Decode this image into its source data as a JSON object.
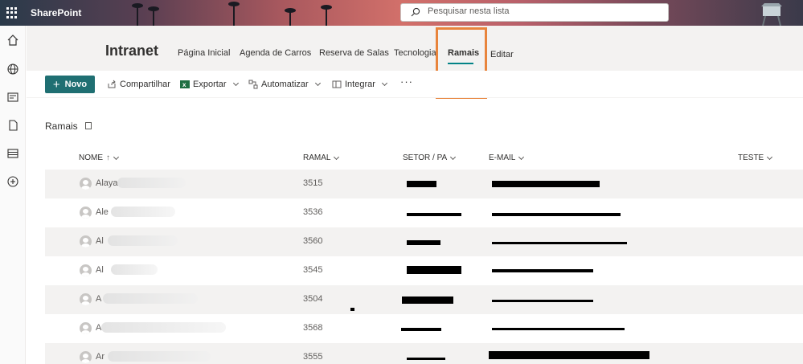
{
  "suite": {
    "brand": "SharePoint",
    "search_placeholder": "Pesquisar nesta lista"
  },
  "site": {
    "title": "Intranet",
    "nav": [
      "Página Inicial",
      "Agenda de Carros",
      "Reserva de Salas",
      "Tecnologia",
      "Ramais",
      "Editar"
    ],
    "active_nav": "Ramais"
  },
  "commands": {
    "new_label": "Novo",
    "share_label": "Compartilhar",
    "export_label": "Exportar",
    "automate_label": "Automatizar",
    "integrate_label": "Integrar",
    "more_label": "···"
  },
  "list": {
    "title": "Ramais",
    "columns": {
      "nome": "NOME",
      "ramal": "RAMAL",
      "setor": "SETOR / PA",
      "email": "E-MAIL",
      "teste": "TESTE"
    },
    "rows": [
      {
        "name": "Alaya",
        "ramal": "3515"
      },
      {
        "name": "Ale",
        "ramal": "3536"
      },
      {
        "name": "Al",
        "ramal": "3560"
      },
      {
        "name": "Al",
        "ramal": "3545"
      },
      {
        "name": "A",
        "ramal": "3504"
      },
      {
        "name": "A",
        "ramal": "3568"
      },
      {
        "name": "Ar",
        "ramal": "3555"
      }
    ]
  },
  "colors": {
    "accent": "#1f6f72",
    "highlight": "#e8843c",
    "active_underline": "#038387"
  }
}
